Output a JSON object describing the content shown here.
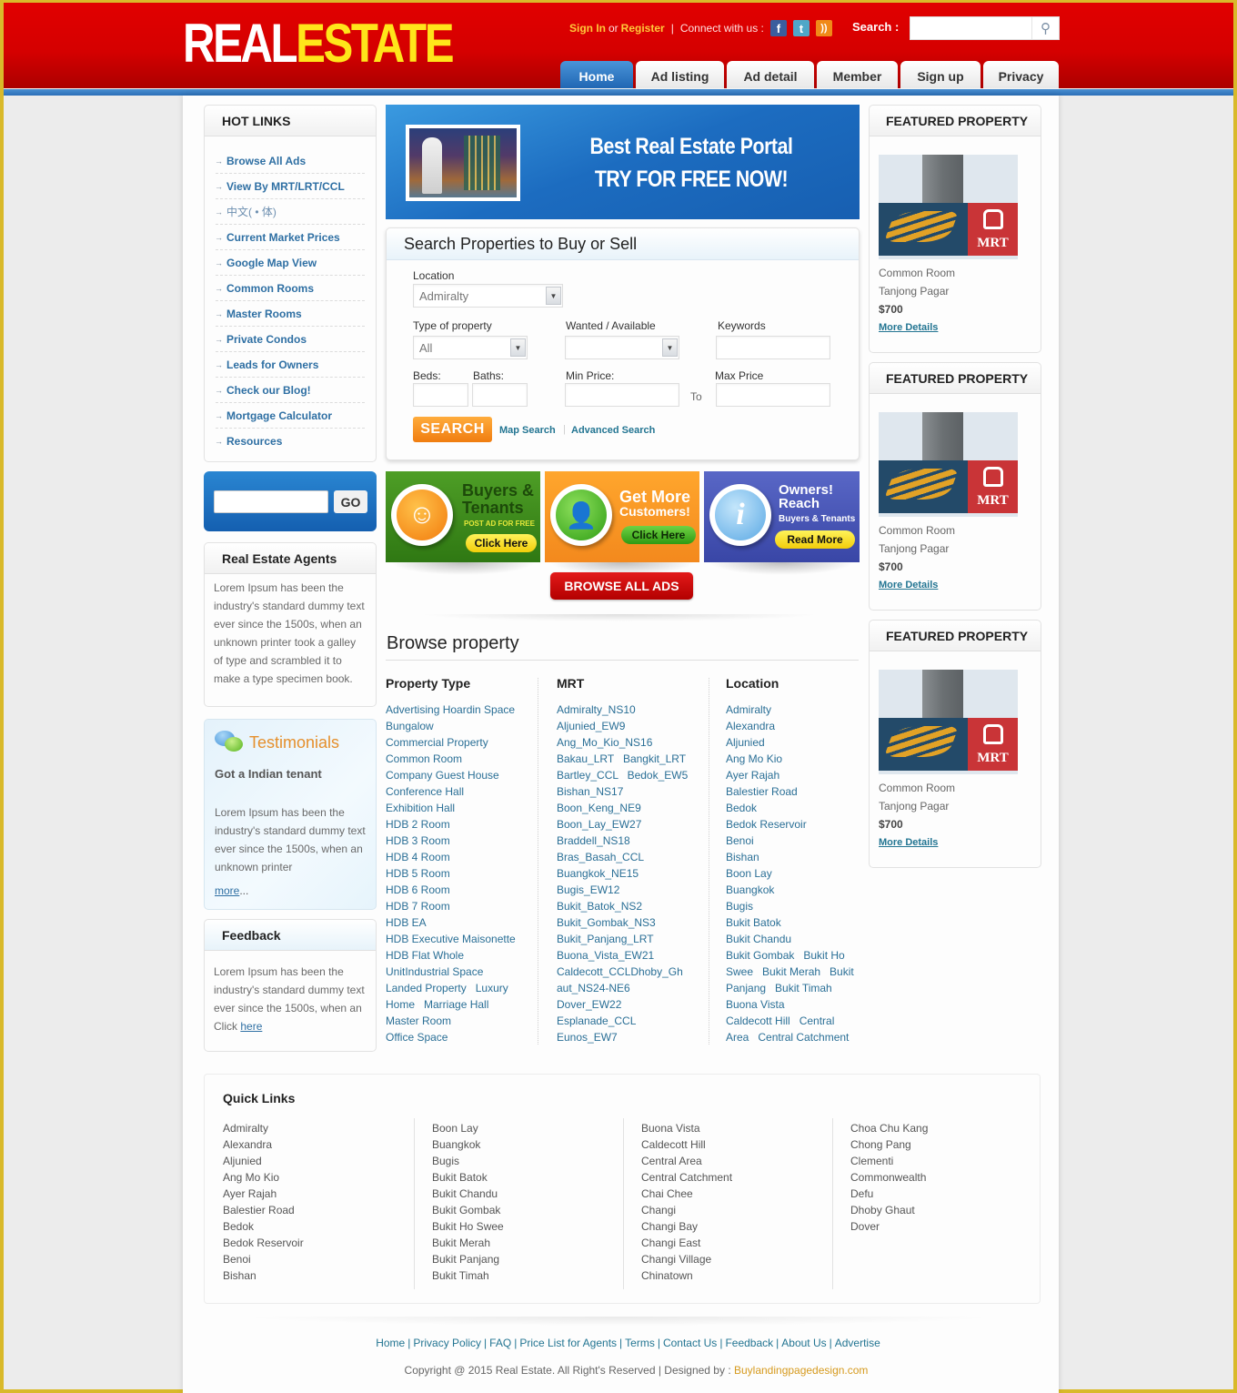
{
  "header": {
    "logo_part1": "REAL",
    "logo_part2": "ESTATE",
    "sign_in": "Sign In",
    "or": "or",
    "register": "Register",
    "separator": "|",
    "connect": "Connect with us :",
    "social": [
      {
        "icon": "facebook-icon",
        "glyph": "f"
      },
      {
        "icon": "twitter-icon",
        "glyph": "t"
      },
      {
        "icon": "rss-icon",
        "glyph": "))"
      }
    ],
    "search_label": "Search :",
    "search_placeholder": "",
    "search_icon_glyph": "⚲"
  },
  "nav": {
    "tabs": [
      {
        "label": "Home",
        "active": true
      },
      {
        "label": "Ad listing",
        "active": false
      },
      {
        "label": "Ad detail",
        "active": false
      },
      {
        "label": "Member",
        "active": false
      },
      {
        "label": "Sign up",
        "active": false
      },
      {
        "label": "Privacy",
        "active": false
      }
    ]
  },
  "hot_links": {
    "title": "HOT LINKS",
    "arrow_glyph": "→",
    "items": [
      "Browse All Ads",
      "View By MRT/LRT/CCL",
      "中文( • 体)",
      "Current Market Prices",
      "Google Map View",
      "Common Rooms",
      "Master Rooms",
      "Private Condos",
      "Leads for Owners",
      "Check our Blog!",
      "Mortgage Calculator",
      "Resources"
    ]
  },
  "go_box": {
    "input_value": "",
    "button_label": "GO"
  },
  "agents": {
    "title": "Real Estate Agents",
    "body": "Lorem Ipsum has been the industry's standard dummy text ever since the 1500s, when an unknown printer took a galley of type and scrambled it to make a type specimen book."
  },
  "testimonials": {
    "title": "Testimonials",
    "subtitle": "Got a Indian tenant",
    "body": "Lorem Ipsum has been the industry's standard dummy text ever since the 1500s, when an unknown printer",
    "more_link": "more",
    "more_suffix": "..."
  },
  "feedback": {
    "title": "Feedback",
    "body": "Lorem Ipsum has been the industry's standard dummy text ever since the 1500s, when an Click ",
    "link": "here"
  },
  "banner": {
    "line1": "Best Real Estate Portal",
    "line2": "TRY FOR FREE NOW!"
  },
  "search_form": {
    "title": "Search Properties to Buy or Sell",
    "location_label": "Location",
    "location_value": "Admiralty",
    "type_label": "Type of property",
    "type_value": "All",
    "wanted_label": "Wanted / Available",
    "wanted_value": "",
    "keywords_label": "Keywords",
    "keywords_value": "",
    "beds_label": "Beds:",
    "baths_label": "Baths:",
    "min_price_label": "Min Price:",
    "to_label": "To",
    "max_price_label": "Max Price",
    "search_button": "SEARCH",
    "map_search": "Map Search",
    "link_separator": "|",
    "advanced_search": "Advanced Search",
    "dropdown_glyph": "▼"
  },
  "promos": [
    {
      "title": "Buyers & Tenants",
      "subtitle": "POST AD FOR FREE",
      "button": "Click Here",
      "icon": "smiley-icon",
      "glyph": "☺"
    },
    {
      "title": "Get More",
      "title2": "Customers!",
      "button": "Click Here",
      "icon": "user-icon",
      "glyph": "👤"
    },
    {
      "title": "Owners!",
      "title2": "Reach",
      "subtitle": "Buyers & Tenants",
      "button": "Read More",
      "icon": "info-icon",
      "glyph": "i"
    }
  ],
  "browse_all_button": "BROWSE ALL ADS",
  "browse": {
    "title": "Browse property",
    "columns": [
      {
        "heading": "Property Type",
        "items": [
          "Advertising Hoardin Space",
          "Bungalow",
          "Commercial Property",
          "Common Room",
          "Company Guest House",
          "Conference Hall",
          "Exhibition Hall",
          "HDB 2 Room",
          "HDB 3 Room",
          "HDB 4 Room",
          "HDB 5 Room",
          "HDB 6 Room",
          "HDB 7 Room",
          "HDB EA",
          "HDB Executive Maisonette",
          "HDB Flat Whole",
          "UnitIndustrial Space",
          "Landed Property   Luxury",
          "Home   Marriage Hall",
          "Master Room",
          "Office Space"
        ]
      },
      {
        "heading": "MRT",
        "items": [
          "Admiralty_NS10",
          "Aljunied_EW9",
          "Ang_Mo_Kio_NS16",
          "Bakau_LRT   Bangkit_LRT",
          "Bartley_CCL   Bedok_EW5",
          "Bishan_NS17",
          "Boon_Keng_NE9",
          "Boon_Lay_EW27",
          "Braddell_NS18",
          "Bras_Basah_CCL",
          "Buangkok_NE15",
          "Bugis_EW12",
          "Bukit_Batok_NS2",
          "Bukit_Gombak_NS3",
          "Bukit_Panjang_LRT",
          "Buona_Vista_EW21",
          "Caldecott_CCLDhoby_Gh",
          "aut_NS24-NE6",
          "Dover_EW22",
          "Esplanade_CCL",
          "Eunos_EW7"
        ]
      },
      {
        "heading": "Location",
        "items": [
          "Admiralty",
          "Alexandra",
          "Aljunied",
          "Ang Mo Kio",
          "Ayer Rajah",
          "Balestier Road",
          "Bedok",
          "Bedok Reservoir",
          "Benoi",
          "Bishan",
          "Boon Lay",
          "Buangkok",
          "Bugis",
          "Bukit Batok",
          "Bukit Chandu",
          "Bukit Gombak   Bukit Ho",
          "Swee   Bukit Merah   Bukit",
          "Panjang   Bukit Timah",
          "Buona Vista",
          "Caldecott Hill   Central",
          "Area   Central Catchment"
        ]
      }
    ]
  },
  "featured": [
    {
      "heading": "FEATURED PROPERTY",
      "type": "Common Room",
      "location": "Tanjong Pagar",
      "price": "$700",
      "link": "More Details",
      "sign_text": "MRT"
    },
    {
      "heading": "FEATURED PROPERTY",
      "type": "Common Room",
      "location": "Tanjong Pagar",
      "price": "$700",
      "link": "More Details",
      "sign_text": "MRT"
    },
    {
      "heading": "FEATURED PROPERTY",
      "type": "Common Room",
      "location": "Tanjong Pagar",
      "price": "$700",
      "link": "More Details",
      "sign_text": "MRT"
    }
  ],
  "quick_links": {
    "title": "Quick Links",
    "columns": [
      [
        "Admiralty",
        "Alexandra",
        "Aljunied",
        "Ang Mo Kio",
        "Ayer Rajah",
        "Balestier Road",
        "Bedok",
        "Bedok Reservoir",
        "Benoi",
        "Bishan"
      ],
      [
        "Boon Lay",
        "Buangkok",
        "Bugis",
        "Bukit Batok",
        "Bukit Chandu",
        "Bukit Gombak",
        "Bukit Ho Swee",
        "Bukit Merah",
        "Bukit Panjang",
        "Bukit Timah"
      ],
      [
        "Buona Vista",
        "Caldecott Hill",
        "Central Area",
        "Central Catchment",
        "Chai Chee",
        "Changi",
        "Changi Bay",
        "Changi East",
        "Changi Village",
        "Chinatown"
      ],
      [
        "Choa Chu Kang",
        "Chong Pang",
        "Clementi",
        "Commonwealth",
        "Defu",
        "Dhoby Ghaut",
        "Dover"
      ]
    ]
  },
  "footer": {
    "links": [
      "Home",
      "Privacy Policy",
      "FAQ",
      "Price List for Agents",
      "Terms",
      "Contact Us",
      "Feedback",
      "About Us",
      "Advertise"
    ],
    "copyright": "Copyright @ 2015 Real Estate. All Right's Reserved  |  Designed by : ",
    "designer": "Buylandingpagedesign.com"
  }
}
